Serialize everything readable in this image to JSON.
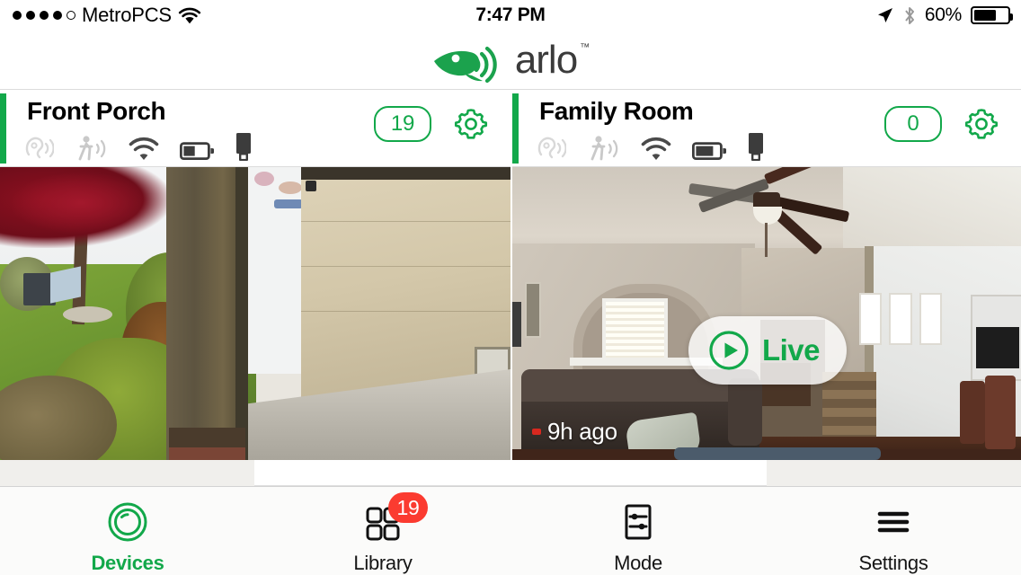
{
  "status_bar": {
    "signal_dots_filled": 4,
    "signal_dots_total": 5,
    "carrier": "MetroPCS",
    "wifi_icon": "wifi-icon",
    "time": "7:47 PM",
    "location_icon": "location-arrow-icon",
    "bluetooth_icon": "bluetooth-icon",
    "battery_percent": "60%",
    "battery_level": 60
  },
  "brand": {
    "logo_icon": "arlo-bird-icon",
    "name": "arlo",
    "trademark": "™",
    "accent_color": "#12a84a"
  },
  "cameras": [
    {
      "name": "Front Porch",
      "accent_color": "#12a84a",
      "status_icons": [
        {
          "name": "audio-detection-icon",
          "state": "off"
        },
        {
          "name": "motion-detection-icon",
          "state": "off"
        },
        {
          "name": "wifi-signal-icon",
          "state": "on"
        },
        {
          "name": "battery-icon",
          "state": "on",
          "level": 45
        },
        {
          "name": "storage-usb-icon",
          "state": "on"
        }
      ],
      "recording_count": "19",
      "settings_icon": "gear-icon",
      "overlay": {
        "live_label": null,
        "timestamp": null
      }
    },
    {
      "name": "Family Room",
      "accent_color": "#12a84a",
      "status_icons": [
        {
          "name": "audio-detection-icon",
          "state": "off"
        },
        {
          "name": "motion-detection-icon",
          "state": "off"
        },
        {
          "name": "wifi-signal-icon",
          "state": "on"
        },
        {
          "name": "battery-icon",
          "state": "on",
          "level": 70
        },
        {
          "name": "storage-usb-icon",
          "state": "on"
        }
      ],
      "recording_count": "0",
      "settings_icon": "gear-icon",
      "overlay": {
        "live_label": "Live",
        "play_icon": "play-circle-icon",
        "timestamp": "9h ago"
      }
    }
  ],
  "tabbar": {
    "items": [
      {
        "label": "Devices",
        "icon": "camera-lens-icon",
        "active": true,
        "badge": null
      },
      {
        "label": "Library",
        "icon": "grid-squares-icon",
        "active": false,
        "badge": "19"
      },
      {
        "label": "Mode",
        "icon": "sliders-box-icon",
        "active": false,
        "badge": null
      },
      {
        "label": "Settings",
        "icon": "hamburger-menu-icon",
        "active": false,
        "badge": null
      }
    ],
    "badge_color": "#fb3b30",
    "active_color": "#12a84a"
  }
}
